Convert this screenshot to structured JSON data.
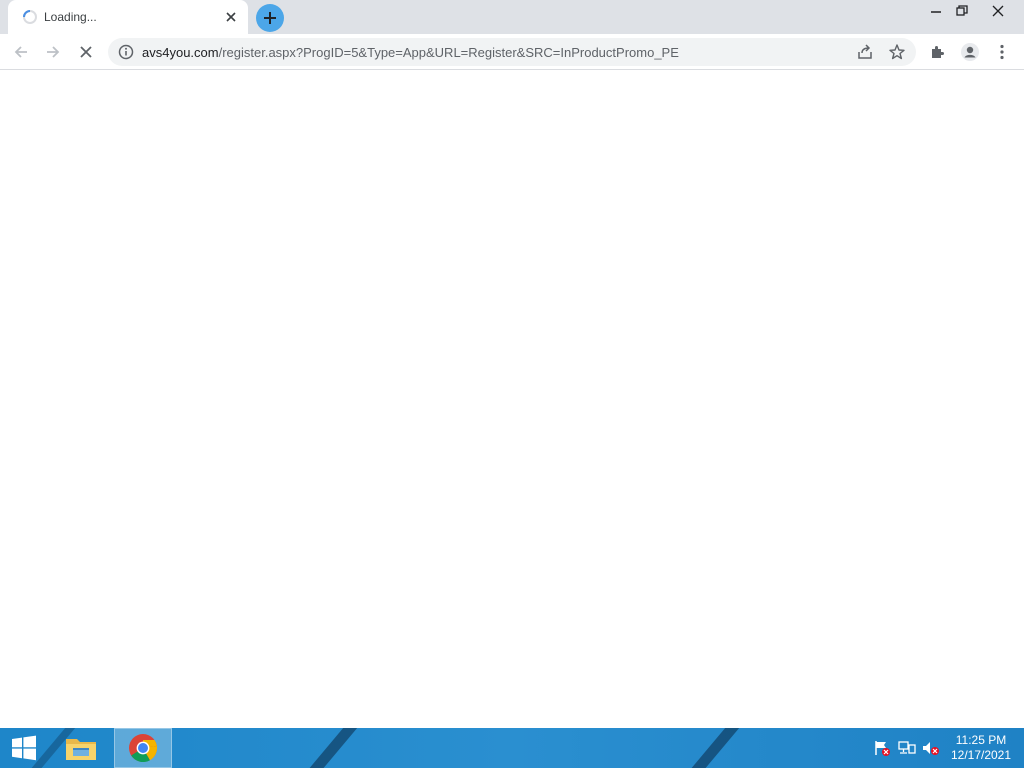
{
  "browser": {
    "tab": {
      "title": "Loading...",
      "close_icon": "close-icon",
      "spinner_icon": "loading-spinner-icon"
    },
    "new_tab_icon": "plus-icon",
    "window_controls": [
      "minimize-icon",
      "restore-icon",
      "close-icon"
    ],
    "toolbar": {
      "back_icon": "arrow-left-icon",
      "forward_icon": "arrow-right-icon",
      "stop_icon": "stop-x-icon",
      "url_host": "avs4you.com",
      "url_path": "/register.aspx?ProgID=5&Type=App&URL=Register&SRC=InProductPromo_PE",
      "share_icon": "share-icon",
      "bookmark_icon": "star-icon",
      "extensions_icon": "puzzle-icon",
      "profile_icon": "profile-icon",
      "menu_icon": "kebab-menu-icon"
    }
  },
  "taskbar": {
    "start_icon": "windows-logo-icon",
    "apps": [
      {
        "name": "File Explorer",
        "icon": "folder-icon",
        "active": false
      },
      {
        "name": "Google Chrome",
        "icon": "chrome-icon",
        "active": true
      }
    ],
    "tray": [
      "action-center-flag-icon",
      "network-icon",
      "volume-muted-icon"
    ],
    "clock": {
      "time": "11:25 PM",
      "date": "12/17/2021"
    }
  },
  "colors": {
    "tabstrip": "#dee1e6",
    "omnibox": "#f1f3f4",
    "new_tab_button": "#4ca6e8",
    "taskbar": "#2a8fd0"
  }
}
